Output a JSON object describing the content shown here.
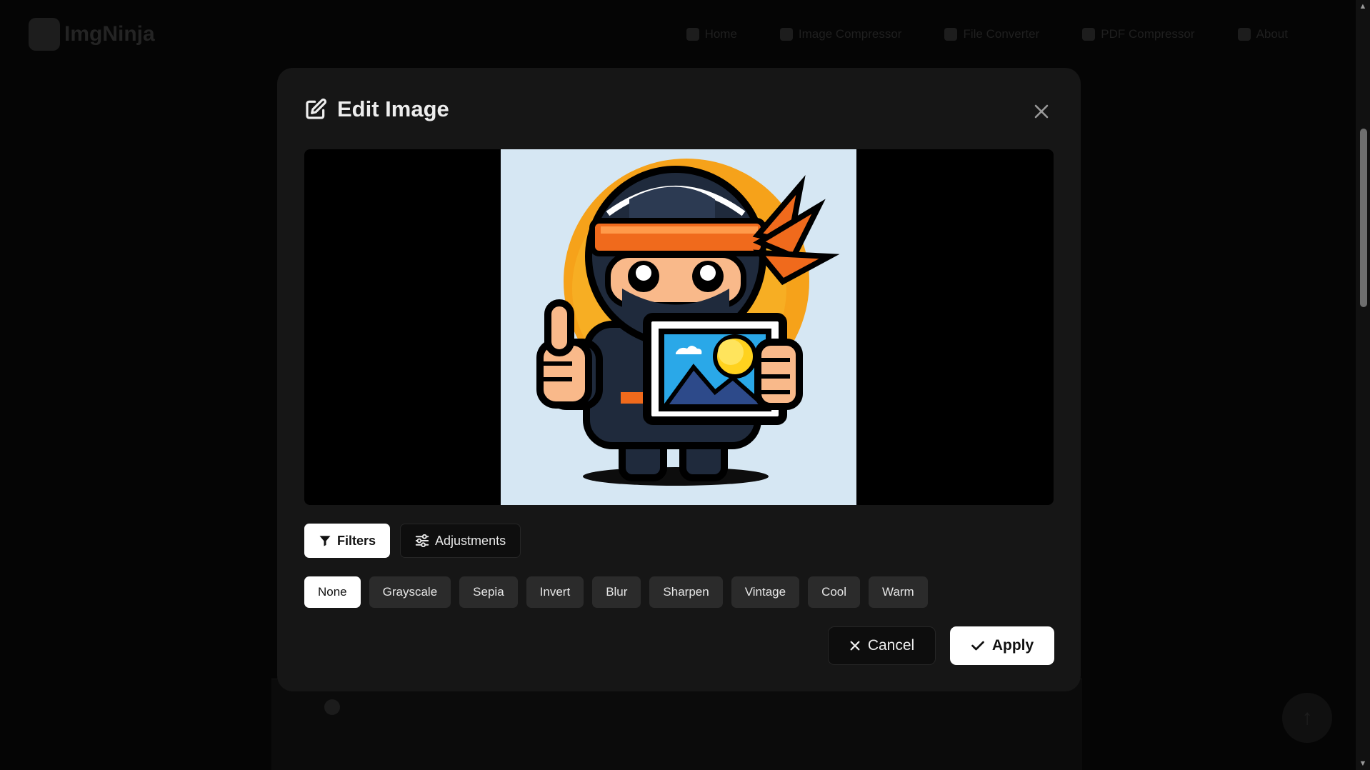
{
  "background": {
    "brand": "ImgNinja",
    "nav": [
      "Home",
      "Image Compressor",
      "File Converter",
      "PDF Compressor",
      "About"
    ],
    "footer_hint": "Scroll to top"
  },
  "modal": {
    "title": "Edit Image",
    "tabs": [
      {
        "label": "Filters",
        "active": true
      },
      {
        "label": "Adjustments",
        "active": false
      }
    ],
    "filters": [
      {
        "label": "None",
        "active": true
      },
      {
        "label": "Grayscale",
        "active": false
      },
      {
        "label": "Sepia",
        "active": false
      },
      {
        "label": "Invert",
        "active": false
      },
      {
        "label": "Blur",
        "active": false
      },
      {
        "label": "Sharpen",
        "active": false
      },
      {
        "label": "Vintage",
        "active": false
      },
      {
        "label": "Cool",
        "active": false
      },
      {
        "label": "Warm",
        "active": false
      }
    ],
    "cancel_label": "Cancel",
    "apply_label": "Apply",
    "preview_icon": "ninja-mascot-image"
  },
  "colors": {
    "modal_bg": "#161616",
    "chip_bg": "#2b2b2b",
    "accent_orange": "#f06a1c",
    "ninja_navy": "#1f2a3c"
  }
}
